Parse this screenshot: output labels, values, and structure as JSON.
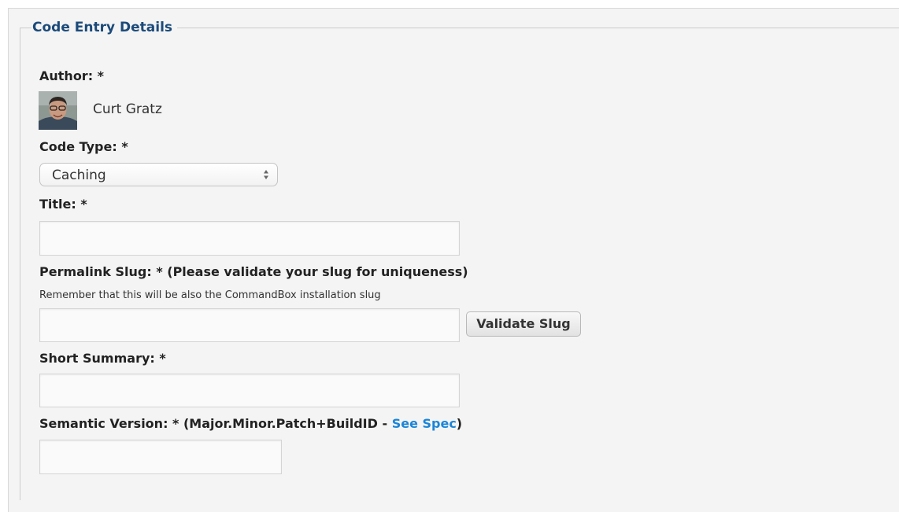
{
  "section": {
    "legend": "Code Entry Details"
  },
  "author": {
    "label": "Author: *",
    "name": "Curt Gratz"
  },
  "code_type": {
    "label": "Code Type: *",
    "selected": "Caching"
  },
  "title_field": {
    "label": "Title: *",
    "value": ""
  },
  "slug": {
    "label": "Permalink Slug: * (Please validate your slug for uniqueness)",
    "help": "Remember that this will be also the CommandBox installation slug",
    "value": "",
    "validate_button": "Validate Slug"
  },
  "summary": {
    "label": "Short Summary: *",
    "value": ""
  },
  "version": {
    "label_prefix": "Semantic Version: * (Major.Minor.Patch+BuildID - ",
    "link": "See Spec",
    "label_suffix": ")",
    "value": ""
  },
  "colors": {
    "legend": "#1b4a7a",
    "link": "#1b85d8",
    "panel_background": "#f4f4f4"
  },
  "icons": {
    "select_arrows": "updown-arrows-icon"
  }
}
